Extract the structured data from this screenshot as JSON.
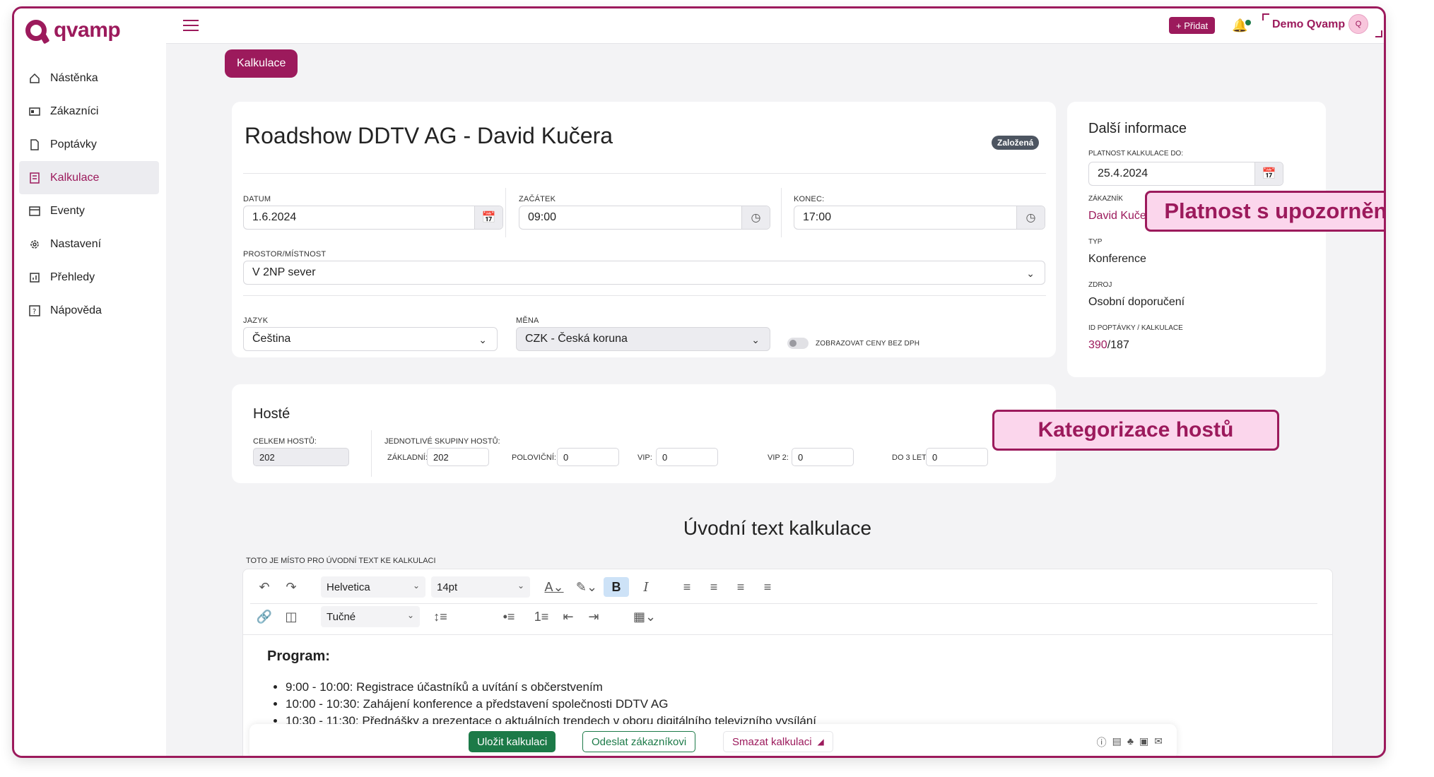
{
  "app": {
    "logo_text": "qvamp",
    "brand_color": "#9c1a5c"
  },
  "sidebar": {
    "items": [
      {
        "label": "Nástěnka",
        "icon": "home-icon"
      },
      {
        "label": "Zákazníci",
        "icon": "id-card-icon"
      },
      {
        "label": "Poptávky",
        "icon": "document-icon"
      },
      {
        "label": "Kalkulace",
        "icon": "calculator-icon"
      },
      {
        "label": "Eventy",
        "icon": "calendar-icon"
      },
      {
        "label": "Nastavení",
        "icon": "gear-icon"
      },
      {
        "label": "Přehledy",
        "icon": "chart-icon"
      },
      {
        "label": "Nápověda",
        "icon": "help-icon"
      }
    ]
  },
  "topbar": {
    "add_label": "+ Přidat",
    "user_name": "Demo Qvamp",
    "avatar_initial": "Q"
  },
  "tab": {
    "label": "Kalkulace"
  },
  "main": {
    "title": "Roadshow DDTV AG - David Kučera",
    "status": "Založená",
    "datum_label": "DATUM",
    "datum_value": "1.6.2024",
    "zacatek_label": "ZAČÁTEK",
    "zacatek_value": "09:00",
    "konec_label": "KONEC:",
    "konec_value": "17:00",
    "prostor_label": "PROSTOR/MÍSTNOST",
    "prostor_value": "V 2NP sever",
    "jazyk_label": "JAZYK",
    "jazyk_value": "Čeština",
    "mena_label": "MĚNA",
    "mena_value": "CZK - Česká koruna",
    "toggle_label": "ZOBRAZOVAT CENY BEZ DPH"
  },
  "info": {
    "title": "Další informace",
    "platnost_label": "PLATNOST KALKULACE DO:",
    "platnost_value": "25.4.2024",
    "zakaznik_label": "ZÁKAZNÍK",
    "zakaznik_value": "David Kučera",
    "typ_label": "TYP",
    "typ_value": "Konference",
    "zdroj_label": "ZDROJ",
    "zdroj_value": "Osobní doporučení",
    "id_label": "ID POPTÁVKY / KALKULACE",
    "id_poptavky": "390",
    "id_kalkulace": "/187"
  },
  "callouts": {
    "platnost": "Platnost s upozorněním",
    "hoste": "Kategorizace hostů"
  },
  "guests": {
    "title": "Hosté",
    "total_label": "CELKEM HOSTŮ:",
    "total_value": "202",
    "groups_label": "JEDNOTLIVÉ SKUPINY HOSTŮ:",
    "zakladni_label": "ZÁKLADNÍ:",
    "zakladni_value": "202",
    "polovicni_label": "POLOVIČNÍ:",
    "polovicni_value": "0",
    "vip_label": "VIP:",
    "vip_value": "0",
    "vip2_label": "VIP 2:",
    "vip2_value": "0",
    "do3_label": "DO 3 LET:",
    "do3_value": "0"
  },
  "editor": {
    "section_title": "Úvodní text kalkulace",
    "note": "TOTO JE MÍSTO PRO ÚVODNÍ TEXT KE KALKULACI",
    "font": "Helvetica",
    "size": "14pt",
    "style": "Tučné",
    "heading": "Program:",
    "items": [
      "9:00 - 10:00: Registrace účastníků a uvítání s občerstvením",
      "10:00 - 10:30: Zahájení konference a představení společnosti DDTV AG",
      "10:30 - 11:30: Přednášky a prezentace o aktuálních trendech v oboru digitálního televizního vysílání"
    ]
  },
  "footer": {
    "save": "Uložit kalkulaci",
    "send": "Odeslat zákazníkovi",
    "delete": "Smazat kalkulaci"
  }
}
